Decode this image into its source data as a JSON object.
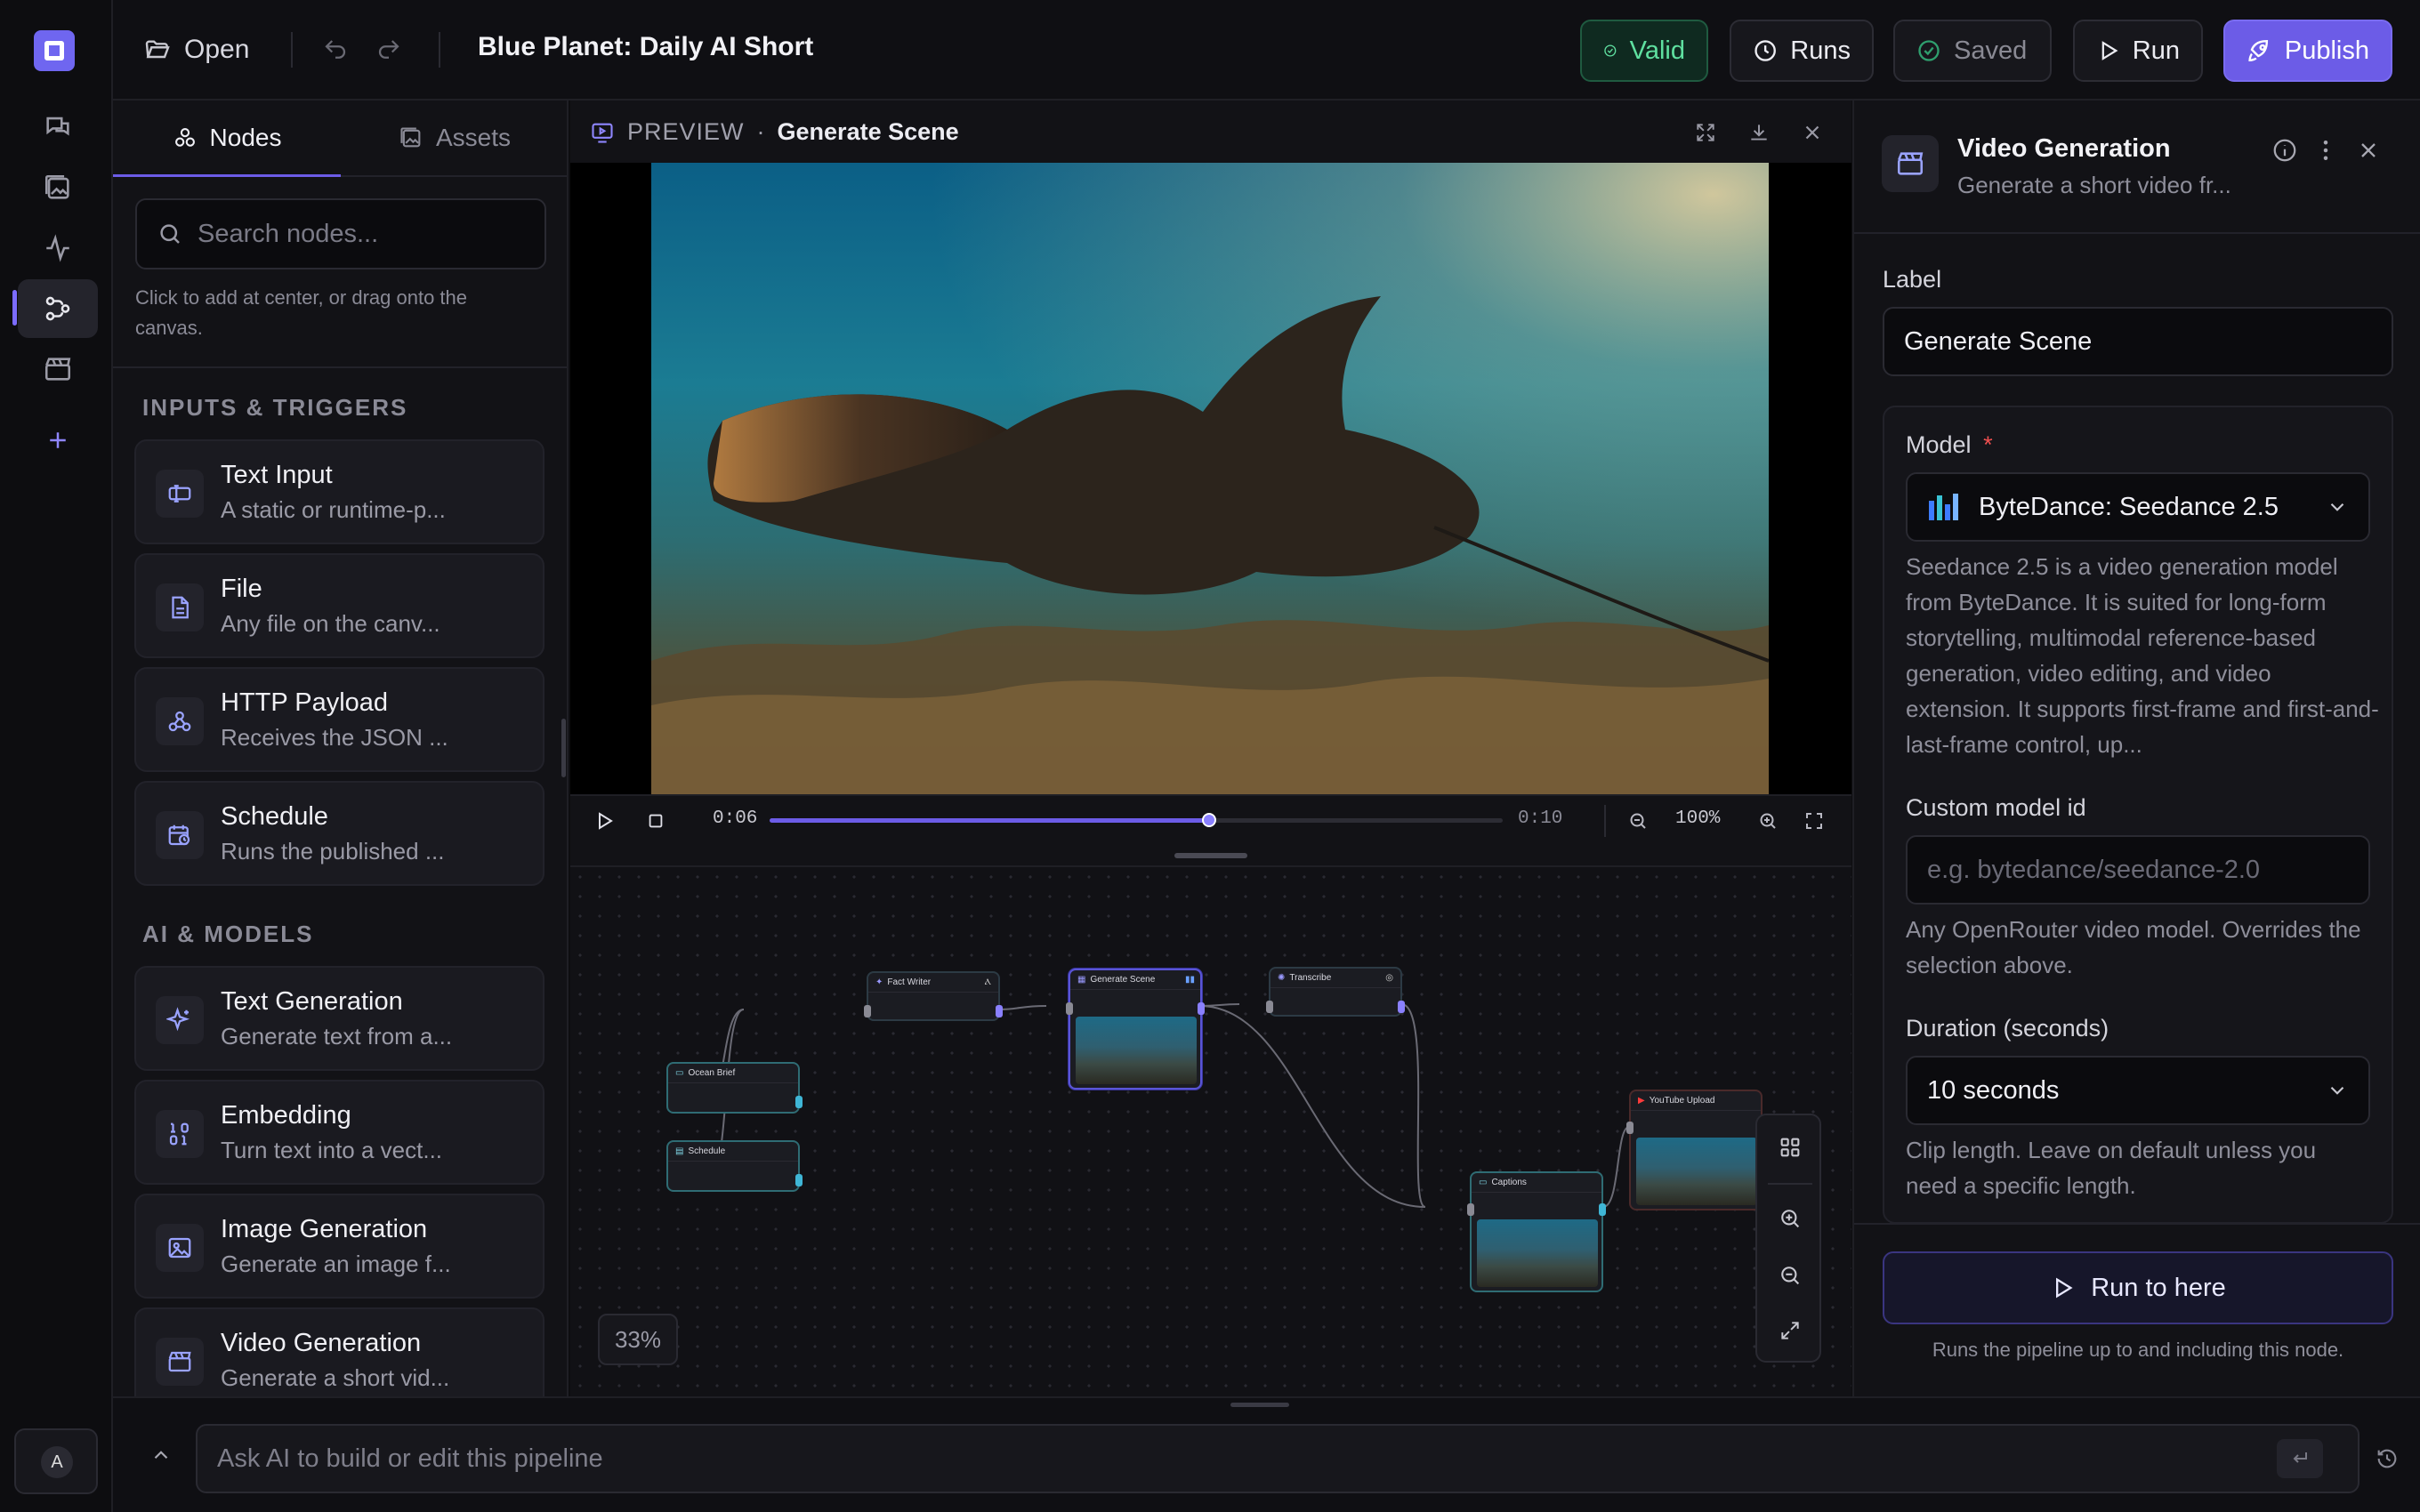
{
  "topbar": {
    "open_label": "Open",
    "title": "Blue Planet: Daily AI Short",
    "valid_label": "Valid",
    "runs_label": "Runs",
    "saved_label": "Saved",
    "run_label": "Run",
    "publish_label": "Publish"
  },
  "rail": {
    "items": [
      "chat-icon",
      "gallery-icon",
      "activity-icon",
      "workflow-icon",
      "clapper-icon",
      "plus-icon"
    ],
    "avatar_letter": "A"
  },
  "left": {
    "tabs": [
      "Nodes",
      "Assets"
    ],
    "search_placeholder": "Search nodes...",
    "hint": "Click to add at center, or drag onto the canvas.",
    "sections": [
      {
        "title": "INPUTS & TRIGGERS",
        "items": [
          {
            "title": "Text Input",
            "desc": "A static or runtime-p..."
          },
          {
            "title": "File",
            "desc": "Any file on the canv..."
          },
          {
            "title": "HTTP Payload",
            "desc": "Receives the JSON ..."
          },
          {
            "title": "Schedule",
            "desc": "Runs the published ..."
          }
        ]
      },
      {
        "title": "AI & MODELS",
        "items": [
          {
            "title": "Text Generation",
            "desc": "Generate text from a..."
          },
          {
            "title": "Embedding",
            "desc": "Turn text into a vect..."
          },
          {
            "title": "Image Generation",
            "desc": "Generate an image f..."
          },
          {
            "title": "Video Generation",
            "desc": "Generate a short vid..."
          }
        ]
      }
    ]
  },
  "preview": {
    "label": "PREVIEW",
    "sep": "·",
    "node_name": "Generate Scene",
    "time_current": "0:06",
    "time_total": "0:10",
    "progress": 0.6,
    "zoom": "100%"
  },
  "canvas": {
    "zoom": "33%",
    "nodes": {
      "ocean_brief": "Ocean Brief",
      "schedule": "Schedule",
      "fact_writer": "Fact Writer",
      "generate_scene": "Generate Scene",
      "transcribe": "Transcribe",
      "captions": "Captions",
      "youtube_upload": "YouTube Upload"
    }
  },
  "right": {
    "title": "Video Generation",
    "subtitle": "Generate a short video fr...",
    "label_label": "Label",
    "label_value": "Generate Scene",
    "model_label": "Model",
    "required_mark": "*",
    "model_value": "ByteDance: Seedance 2.5",
    "model_desc": "Seedance 2.5 is a video generation model from ByteDance. It is suited for long-form storytelling, multimodal reference-based generation, video editing, and video extension. It supports first-frame and first-and-last-frame control, up...",
    "custom_label": "Custom model id",
    "custom_placeholder": "e.g. bytedance/seedance-2.0",
    "custom_help": "Any OpenRouter video model. Overrides the selection above.",
    "duration_label": "Duration (seconds)",
    "duration_value": "10 seconds",
    "duration_help": "Clip length. Leave on default unless you need a specific length.",
    "run_here_label": "Run to here",
    "run_here_help": "Runs the pipeline up to and including this node."
  },
  "bottom": {
    "ask_placeholder": "Ask AI to build or edit this pipeline"
  },
  "colors": {
    "accent": "#6c5ce7",
    "valid_green": "#3fcf8e",
    "required_red": "#ef4f4f"
  }
}
